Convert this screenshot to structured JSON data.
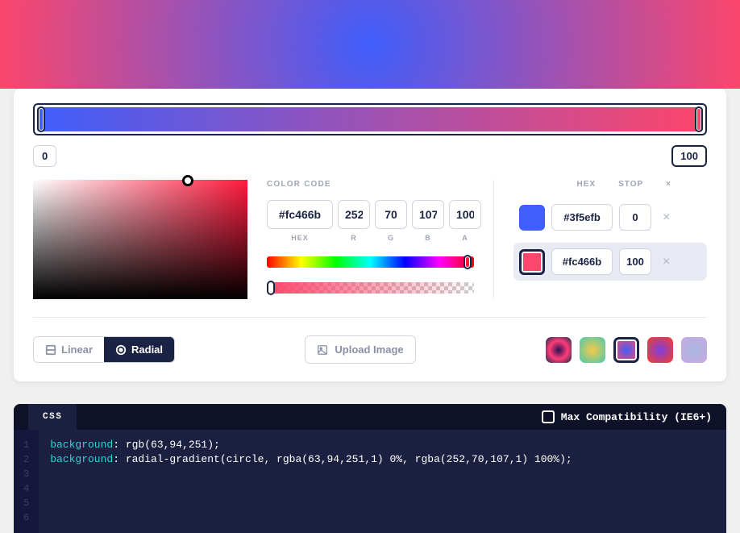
{
  "gradient": {
    "stops": [
      {
        "color": "#3f5efb",
        "pos": 0
      },
      {
        "color": "#fc466b",
        "pos": 100
      }
    ],
    "active_stop": 1,
    "type": "radial"
  },
  "stop_positions": {
    "left": "0",
    "right": "100"
  },
  "color_code": {
    "label": "COLOR CODE",
    "hex": "#fc466b",
    "r": "252",
    "g": "70",
    "b": "107",
    "a": "100",
    "labels": {
      "hex": "HEX",
      "r": "R",
      "g": "G",
      "b": "B",
      "a": "A"
    }
  },
  "stops_table": {
    "headers": {
      "hex": "HEX",
      "stop": "STOP",
      "delete": "×"
    },
    "rows": [
      {
        "color": "#3f5efb",
        "hex": "#3f5efb",
        "stop": "0",
        "active": false
      },
      {
        "color": "#fc466b",
        "hex": "#fc466b",
        "stop": "100",
        "active": true
      }
    ]
  },
  "type_buttons": {
    "linear": "Linear",
    "radial": "Radial"
  },
  "upload_label": "Upload Image",
  "presets": [
    {
      "css": "radial-gradient(circle,#2b1055,#ff3c78,#0d2b4a)"
    },
    {
      "css": "radial-gradient(circle,#f7c948,#48c9b0)"
    },
    {
      "css": "radial-gradient(circle,#3f5efb,#fc466b)",
      "active": true
    },
    {
      "css": "radial-gradient(circle,#7b3fe4,#fc3d21)"
    },
    {
      "css": "radial-gradient(circle,#a9b8e0,#c9a9e0)"
    }
  ],
  "code_output": {
    "tab": "CSS",
    "compat_label": "Max Compatibility (IE6+)",
    "lines": [
      {
        "kw": "background",
        "rest": ": rgb(63,94,251);"
      },
      {
        "kw": "background",
        "rest": ": radial-gradient(circle, rgba(63,94,251,1) 0%, rgba(252,70,107,1) 100%);"
      }
    ]
  }
}
